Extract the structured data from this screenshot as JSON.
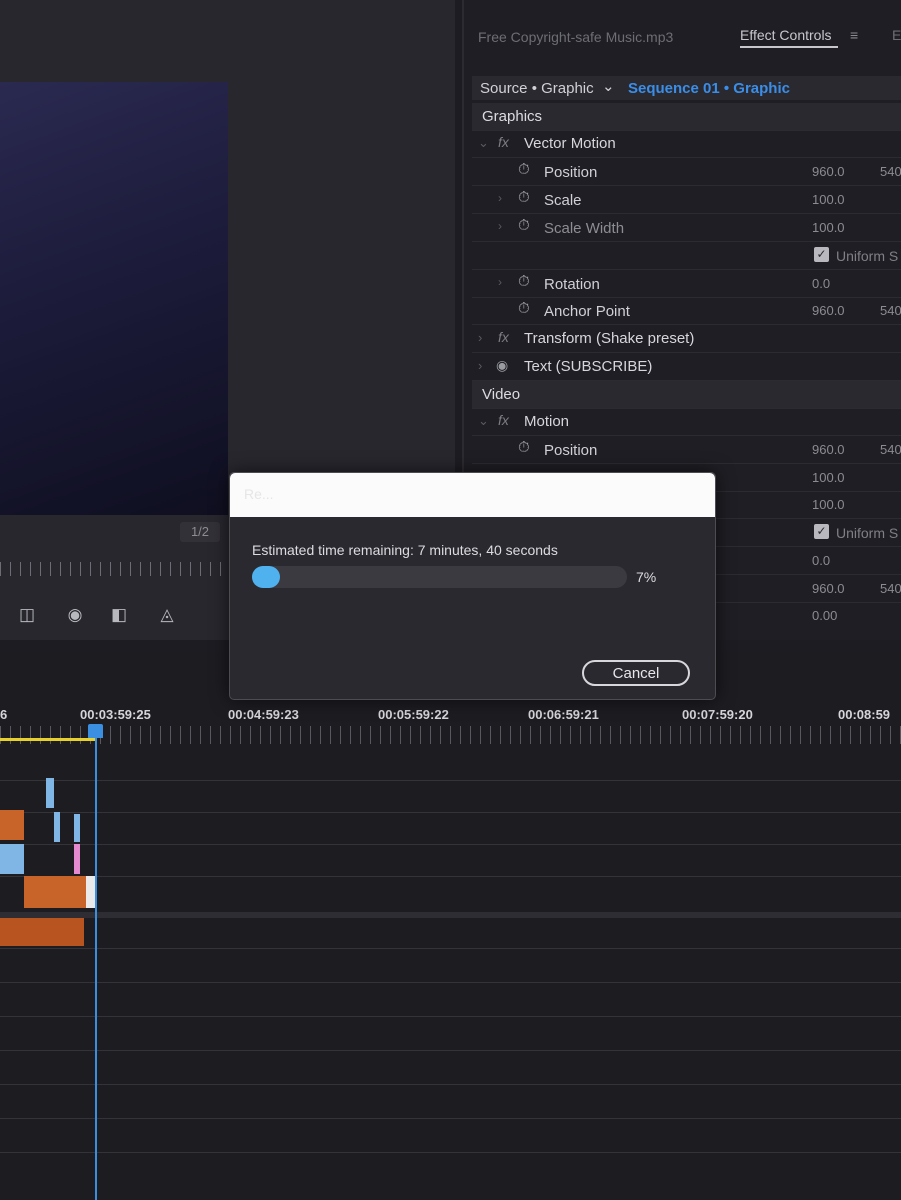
{
  "effect_controls": {
    "tabs": {
      "audio_clip": "Free Copyright-safe Music.mp3",
      "effect_controls": "Effect Controls",
      "menu_icon": "≡",
      "more": "E"
    },
    "source": {
      "label": "Source • Graphic",
      "chevron_icon": "chevron-down-icon",
      "sequence": "Sequence 01 • Graphic"
    },
    "sections": {
      "graphics": "Graphics",
      "video": "Video"
    },
    "graphics_effects": {
      "vector_motion": {
        "name": "Vector Motion",
        "position": {
          "label": "Position",
          "x": "960.0",
          "y": "540"
        },
        "scale": {
          "label": "Scale",
          "value": "100.0"
        },
        "scale_width": {
          "label": "Scale Width",
          "value": "100.0"
        },
        "uniform_scale": {
          "label": "Uniform S"
        },
        "rotation": {
          "label": "Rotation",
          "value": "0.0"
        },
        "anchor_point": {
          "label": "Anchor Point",
          "x": "960.0",
          "y": "540"
        }
      },
      "transform": {
        "name": "Transform (Shake preset)"
      },
      "text": {
        "name": "Text (SUBSCRIBE)"
      }
    },
    "video_effects": {
      "motion": {
        "name": "Motion",
        "position": {
          "label": "Position",
          "x": "960.0",
          "y": "540"
        },
        "scale_value": "100.0",
        "scale_width_value": "100.0",
        "uniform_scale": {
          "label": "Uniform S"
        },
        "rotation_value": "0.0",
        "anchor": {
          "x": "960.0",
          "y": "540"
        },
        "anti_flicker_value": "0.00"
      }
    }
  },
  "monitor": {
    "page_indicator": "1/2",
    "buttons": [
      "export-frame-icon",
      "camera-icon",
      "insert-icon",
      "overwrite-icon"
    ]
  },
  "dialog": {
    "title": "Re...",
    "status": "Estimated time remaining: 7 minutes, 40 seconds",
    "progress": 0.07,
    "progress_label": "7%",
    "cancel_label": "Cancel"
  },
  "timeline": {
    "timecodes": [
      "6",
      "00:03:59:25",
      "00:04:59:23",
      "00:05:59:22",
      "00:06:59:21",
      "00:07:59:20",
      "00:08:59"
    ]
  },
  "colors": {
    "accent_blue": "#3a8ee8",
    "progress_fill": "#4fb2ef",
    "work_area": "#e8d12b",
    "clip_orange": "#c8642a",
    "clip_blue": "#7fb6e6",
    "clip_pink": "#e58ad0"
  }
}
